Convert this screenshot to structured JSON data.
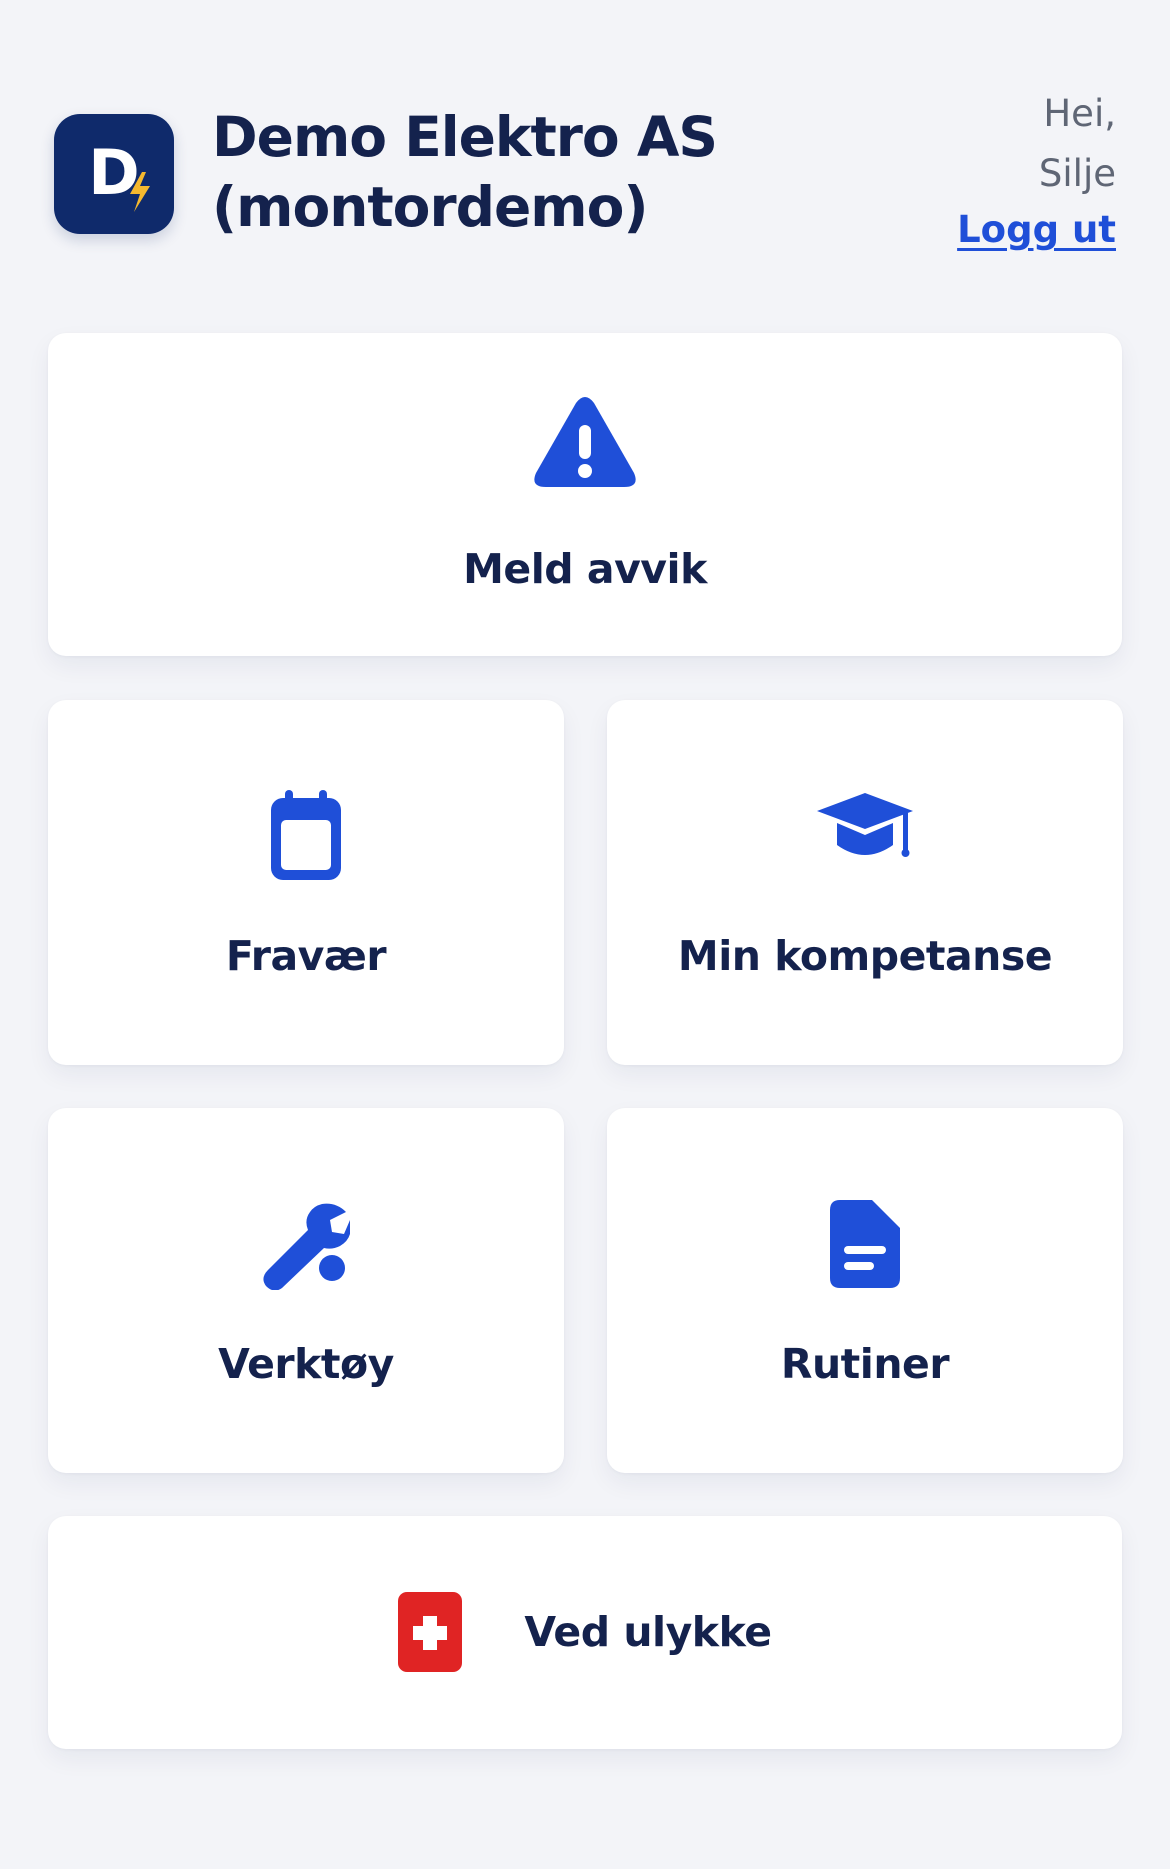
{
  "header": {
    "company_name": "Demo Elektro AS (montordemo)",
    "greeting_line1": "Hei,",
    "greeting_line2": "Silje",
    "logout_label": "Logg ut",
    "logo_letter": "D"
  },
  "tiles": {
    "report": {
      "label": "Meld avvik",
      "icon": "warning-triangle-icon"
    },
    "absence": {
      "label": "Fravær",
      "icon": "calendar-icon"
    },
    "competence": {
      "label": "Min kompetanse",
      "icon": "graduation-cap-icon"
    },
    "tools": {
      "label": "Verktøy",
      "icon": "wrench-icon"
    },
    "routines": {
      "label": "Rutiner",
      "icon": "document-icon"
    },
    "accident": {
      "label": "Ved ulykke",
      "icon": "first-aid-icon"
    }
  },
  "colors": {
    "background": "#f3f4f8",
    "card": "#ffffff",
    "text": "#14224d",
    "accent": "#1f4fd8",
    "logo_bg": "#0f2a6b",
    "bolt": "#f5b82e",
    "danger": "#e02424",
    "muted": "#5f6675"
  }
}
